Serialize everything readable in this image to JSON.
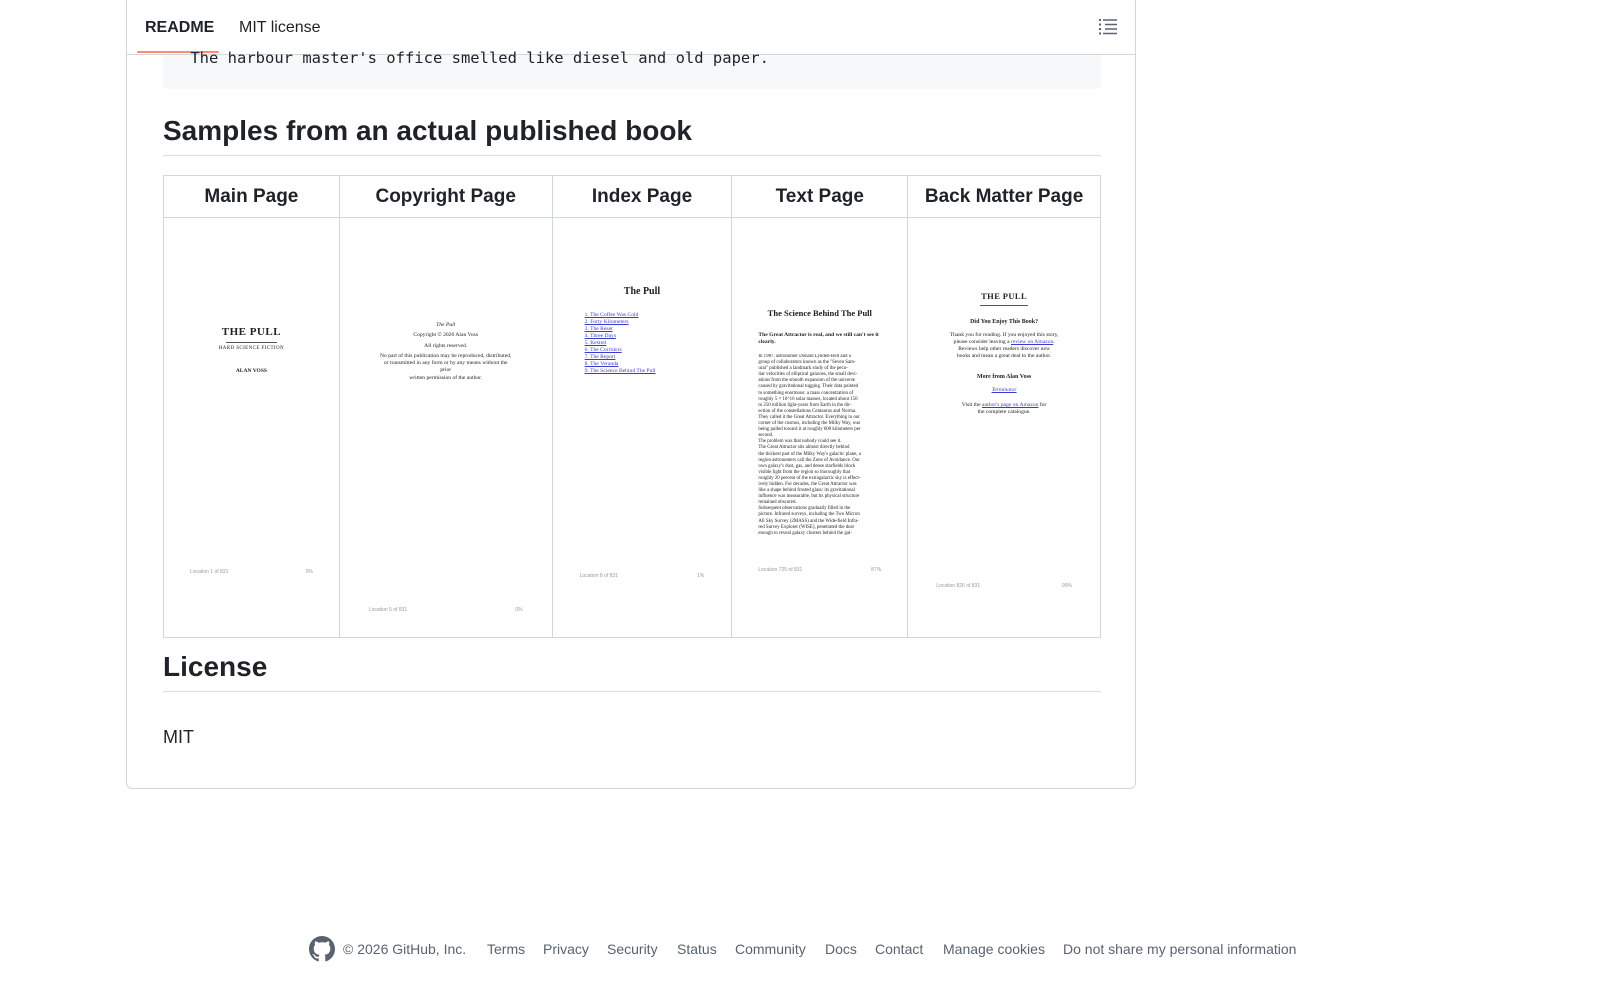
{
  "tabs": {
    "readme": "README",
    "license": "MIT license"
  },
  "code_line": " The harbour master's office smelled like diesel and old paper.",
  "samples_heading": "Samples from an actual published book",
  "table_headers": [
    "Main Page",
    "Copyright Page",
    "Index Page",
    "Text Page",
    "Back Matter Page"
  ],
  "main_page": {
    "title": "THE PULL",
    "subtitle": "HARD SCIENCE FICTION",
    "author": "ALAN VOSS",
    "location": "Location 1 of 831",
    "percent": "0%"
  },
  "copyright_page": {
    "title": "The Pull",
    "line1": "Copyright © 2026 Alan Voss",
    "line2": "All rights reserved.",
    "line3": "No part of this publication may be reproduced, distributed,",
    "line4": "or transmitted in any form or by any means without the",
    "line5": "prior",
    "line6": "written permission of the author.",
    "location": "Location 5 of 831",
    "percent": "0%"
  },
  "index_page": {
    "title": "The Pull",
    "items": [
      "1. The Coffee Was Cold",
      "2. Forty Kilometers",
      "3. The Reset",
      "4. Three Days",
      "5. Kestrel",
      "6. The Corridors",
      "7. The Report",
      "8. The Veranda",
      "9. The Science Behind The Pull"
    ],
    "location": "Location 8 of 831",
    "percent": "1%"
  },
  "text_page": {
    "title": "The Science Behind The Pull",
    "lead": "The Great Attractor is real, and we still can't see it clearly.",
    "body": [
      "In 1987, astronomer Donald Lynden-Bell and a",
      "group of collaborators known as the \"Seven Sam-",
      "urai\" published a landmark study of the pecu-",
      "liar velocities of elliptical galaxies, the small devi-",
      "ations from the smooth expansion of the universe",
      "caused by gravitational tugging. Their data pointed",
      "to something enormous: a mass concentration of",
      "roughly 5 × 10^16 solar masses, located about 150",
      "to 250 million light-years from Earth in the dir-",
      "ection of the constellations Centaurus and Norma.",
      "They called it the Great Attractor. Everything in our",
      "corner of the cosmos, including the Milky Way, was",
      "being pulled toward it at roughly 600 kilometers per",
      "second.",
      "The problem was that nobody could see it.",
      "The Great Attractor sits almost directly behind",
      "the thickest part of the Milky Way's galactic plane, a",
      "region astronomers call the Zone of Avoidance. Our",
      "own galaxy's dust, gas, and dense starfields block",
      "visible light from the region so thoroughly that",
      "roughly 20 percent of the extragalactic sky is effect-",
      "ively hidden. For decades, the Great Attractor was",
      "like a shape behind frosted glass: its gravitational",
      "influence was measurable, but its physical structure",
      "remained obscured.",
      "Subsequent observations gradually filled in the",
      "picture. Infrared surveys, including the Two Micron",
      "All Sky Survey (2MASS) and the Wide-field Infra-",
      "red Survey Explorer (WISE), penetrated the dust",
      "enough to reveal galaxy clusters behind the gal-"
    ],
    "location": "Location 725 of 831",
    "percent": "87%"
  },
  "back_page": {
    "title": "THE PULL",
    "question": "Did You Enjoy This Book?",
    "p1a": "Thank you for reading. If you enjoyed this story,",
    "p1b": "please consider leaving a",
    "p1link": "review on Amazon",
    "p1c": "Reviews help other readers discover new",
    "p1d": "books and mean a great deal to the author.",
    "more": "More from Alan Voss",
    "morelink": "Terminator",
    "visit_a": "Visit the",
    "visit_link": "author's page on Amazon",
    "visit_b": "for",
    "visit_c": "the complete catalogue.",
    "location": "Location 826 of 831",
    "percent": "99%"
  },
  "license_heading": "License",
  "license_text": "MIT",
  "footer": {
    "copyright": "© 2026 GitHub, Inc.",
    "links": [
      "Terms",
      "Privacy",
      "Security",
      "Status",
      "Community",
      "Docs",
      "Contact",
      "Manage cookies",
      "Do not share my personal information"
    ]
  }
}
